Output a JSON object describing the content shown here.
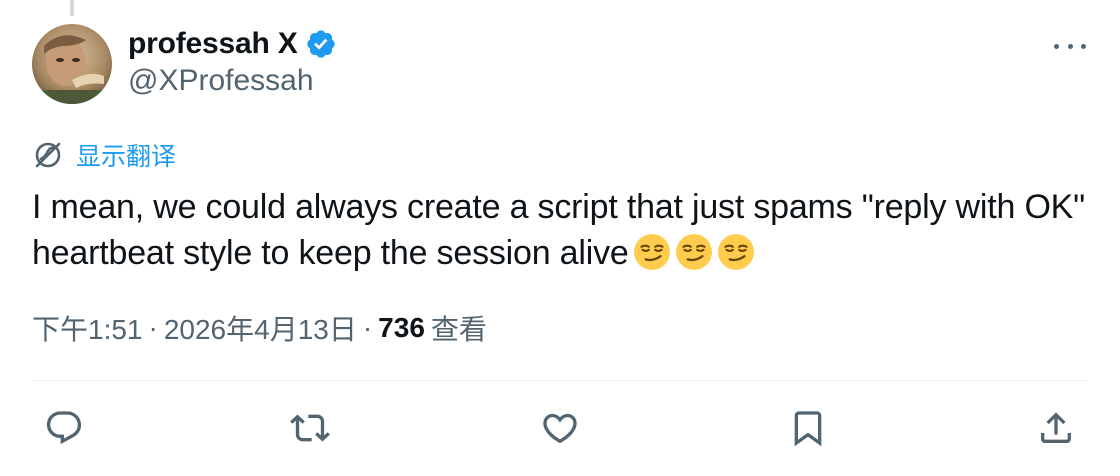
{
  "author": {
    "display_name": "professah X",
    "handle": "@XProfessah",
    "verified": true,
    "avatar": "profile-photo"
  },
  "translate_label": "显示翻译",
  "tweet": {
    "text": "I mean, we could always create a script that just spams \"reply with OK\" heartbeat style to keep the session alive",
    "emojis": [
      "smirking-face",
      "smirking-face",
      "smirking-face"
    ]
  },
  "meta": {
    "time": "下午1:51",
    "separator": "·",
    "date": "2026年4月13日",
    "views_count": "736",
    "views_label": "查看"
  },
  "actions": [
    "reply-icon",
    "retweet-icon",
    "like-icon",
    "bookmark-icon",
    "share-icon"
  ],
  "colors": {
    "text": "#0f1419",
    "secondary": "#536471",
    "accent": "#1d9bf0",
    "divider": "#eff3f4"
  }
}
